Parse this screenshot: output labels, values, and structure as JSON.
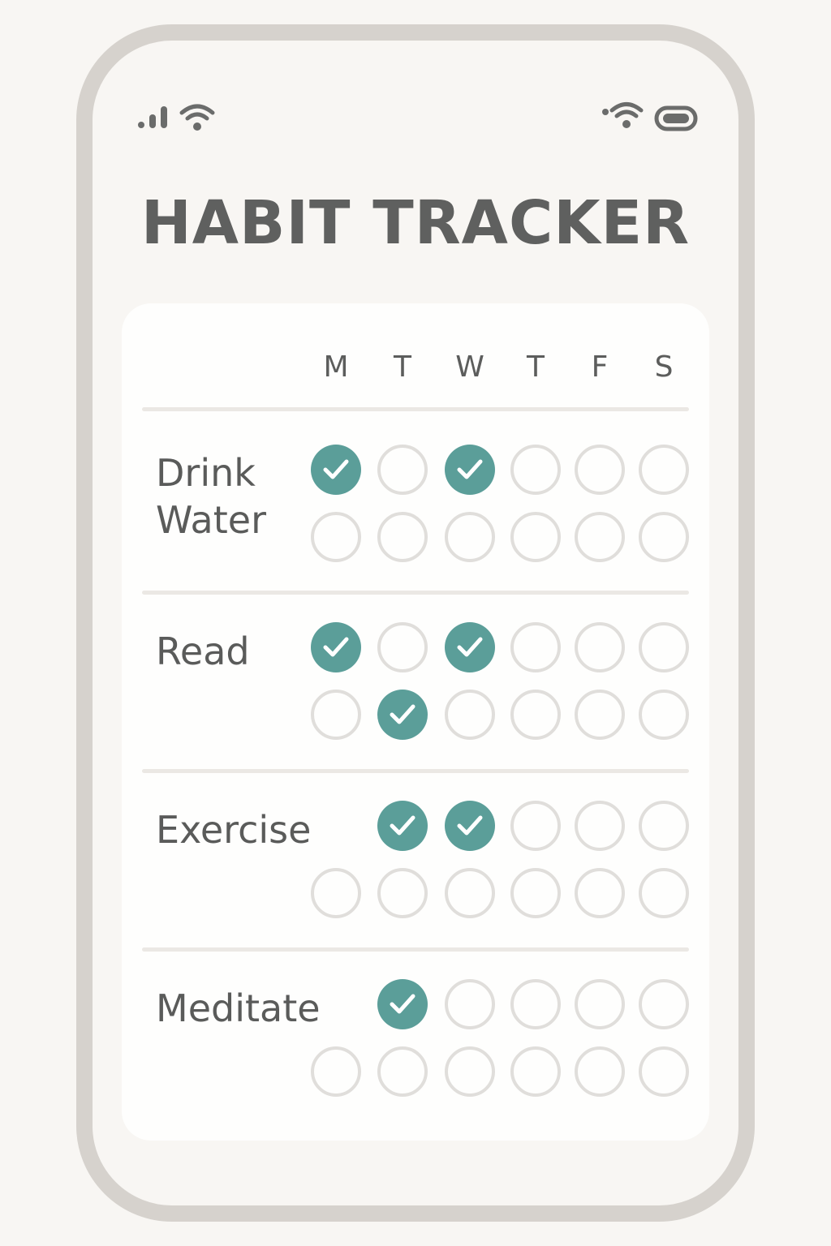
{
  "app": {
    "title": "HABIT TRACKER"
  },
  "status_bar": {
    "left_icons": [
      "signal-icon",
      "wifi-icon"
    ],
    "right_icons": [
      "wifi-icon",
      "battery-icon"
    ]
  },
  "tracker": {
    "days": [
      "M",
      "T",
      "W",
      "T",
      "F",
      "S"
    ],
    "habits": [
      {
        "name": "Drink\nWater",
        "weeks": [
          [
            true,
            false,
            true,
            false,
            false,
            false
          ],
          [
            false,
            false,
            false,
            false,
            false,
            false
          ]
        ]
      },
      {
        "name": "Read",
        "weeks": [
          [
            true,
            false,
            true,
            false,
            false,
            false
          ],
          [
            false,
            true,
            false,
            false,
            false,
            false
          ]
        ]
      },
      {
        "name": "Exercise",
        "weeks": [
          [
            null,
            true,
            true,
            false,
            false,
            false
          ],
          [
            false,
            false,
            false,
            false,
            false,
            false
          ]
        ]
      },
      {
        "name": "Meditate",
        "weeks": [
          [
            null,
            true,
            false,
            false,
            false,
            false
          ],
          [
            false,
            false,
            false,
            false,
            false,
            false
          ]
        ]
      }
    ]
  },
  "colors": {
    "accent": "#5b9e99",
    "check": "#ffffff",
    "empty_ring": "#e0dedb",
    "text": "#5a5b5a",
    "phone_frame": "#d6d2cd",
    "background": "#f8f6f3",
    "card": "#fefefd"
  }
}
